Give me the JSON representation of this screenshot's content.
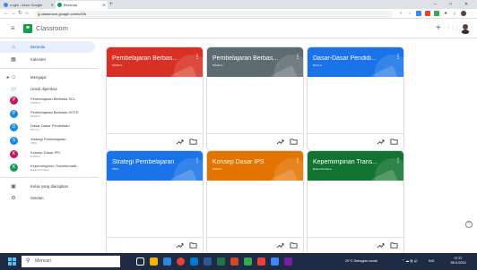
{
  "browser": {
    "tabs": [
      {
        "label": "Login - Akun Google",
        "color": "#4285f4"
      },
      {
        "label": "Beranda",
        "color": "#0f9d58"
      }
    ],
    "url": "classroom.google.com/u/0/h",
    "new_tab": "+",
    "window_controls": [
      "–",
      "□",
      "✕"
    ]
  },
  "header": {
    "app_title": "Classroom",
    "add_label": "+",
    "apps_label": "⋮⋮⋮"
  },
  "sidebar": {
    "top_items": [
      {
        "label": "Beranda",
        "icon": "home-icon"
      },
      {
        "label": "Kalender",
        "icon": "calendar-icon"
      }
    ],
    "teaching_label": "Mengajar",
    "review_label": "Untuk diperiksa",
    "courses": [
      {
        "name": "Pembelajaran Berbasis SCL",
        "sub": "PGMI IV",
        "initial": "P",
        "color": "#c2185b"
      },
      {
        "name": "Pembelajaran Berbasis HOTS",
        "sub": "PGMI IV",
        "initial": "P",
        "color": "#1e88e5"
      },
      {
        "name": "Dasar-Dasar Pendidikan",
        "sub": "PAI II A",
        "initial": "D",
        "color": "#1e88e5"
      },
      {
        "name": "Strategi Pembelajaran",
        "sub": "TBI II",
        "initial": "S",
        "color": "#1e88e5"
      },
      {
        "name": "Konsep Dasar IPS",
        "sub": "PGMI IV",
        "initial": "K",
        "color": "#c2185b"
      },
      {
        "name": "Kepemimpinan Transformatif...",
        "sub": "Bulan Purnama",
        "initial": "K",
        "color": "#0f9d58"
      }
    ],
    "bottom_items": [
      {
        "label": "Kelas yang diarsipkan",
        "icon": "archive-icon"
      },
      {
        "label": "Setelan",
        "icon": "settings-icon"
      }
    ]
  },
  "cards": [
    {
      "title": "Pembelajaran Berbas...",
      "sub": "PGMI IV",
      "color": "#d93025"
    },
    {
      "title": "Pembelajaran Berbas...",
      "sub": "PGMI IV",
      "color": "#5f6b73"
    },
    {
      "title": "Dasar-Dasar Pendidi...",
      "sub": "PAI II A",
      "color": "#1a73e8"
    },
    {
      "title": "Strategi Pembelajaran",
      "sub": "TBI II",
      "color": "#1a73e8"
    },
    {
      "title": "Konsep Dasar IPS",
      "sub": "PGMI IV",
      "color": "#e37400"
    },
    {
      "title": "Kepemimpinan Trans...",
      "sub": "Bulan Purnama",
      "color": "#137333"
    }
  ],
  "help_label": "?",
  "taskbar": {
    "search_placeholder": "Mencari",
    "weather": "29°C Sebagian cerah",
    "lang": "IND",
    "time": "07:37",
    "date": "28/11/2023",
    "apps": [
      {
        "name": "task-view",
        "color": "#ffffff"
      },
      {
        "name": "file-explorer",
        "color": "#f4b400"
      },
      {
        "name": "edge",
        "color": "#2b88d8"
      },
      {
        "name": "chrome",
        "color": "#ea4335"
      },
      {
        "name": "store",
        "color": "#0078d4"
      },
      {
        "name": "word",
        "color": "#2b579a"
      },
      {
        "name": "excel",
        "color": "#217346"
      },
      {
        "name": "powerpoint",
        "color": "#d24726"
      },
      {
        "name": "app-green",
        "color": "#34a853"
      },
      {
        "name": "app-red",
        "color": "#ea4335"
      },
      {
        "name": "app-blue",
        "color": "#4285f4"
      },
      {
        "name": "app-purple",
        "color": "#7b1fa2"
      }
    ]
  }
}
